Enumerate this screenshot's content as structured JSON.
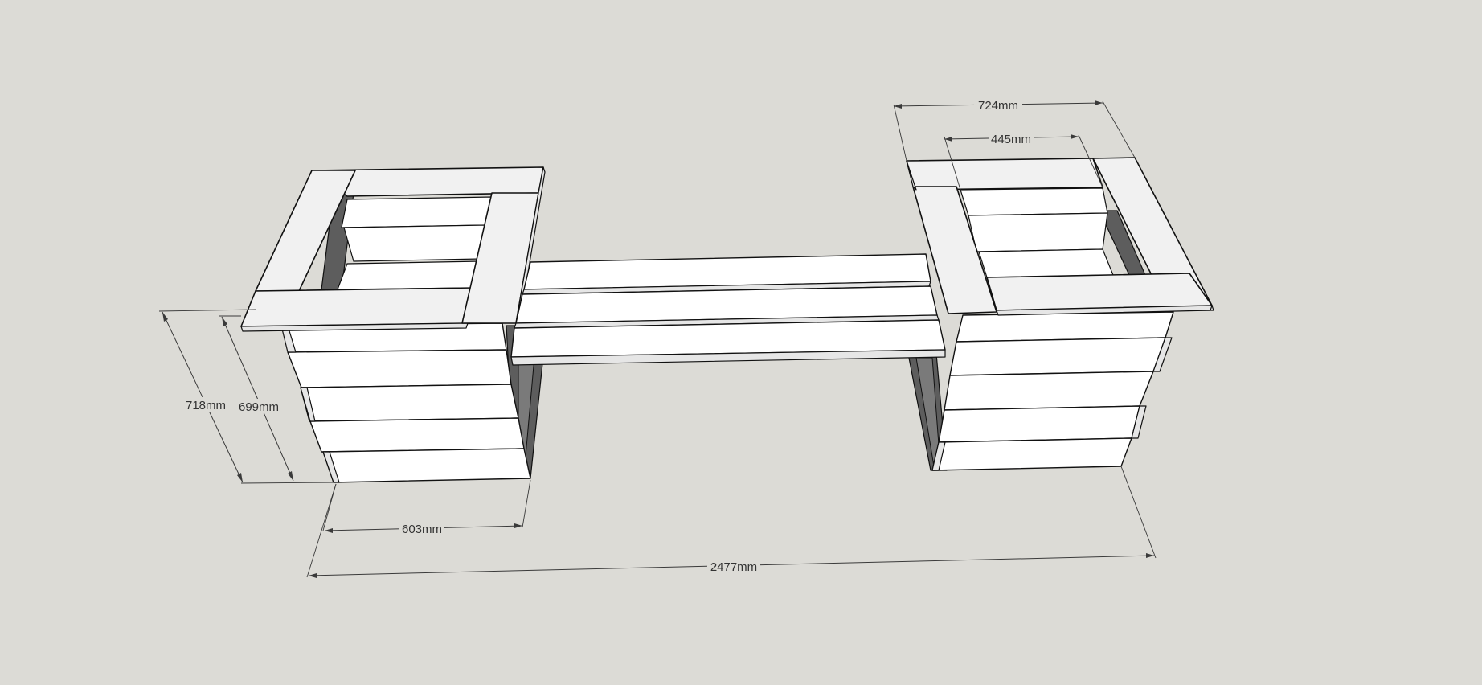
{
  "dimensions": {
    "right_outer_width": "724mm",
    "right_inner_width": "445mm",
    "left_height_overall": "718mm",
    "left_height_box": "699mm",
    "left_box_width": "603mm",
    "total_length": "2477mm"
  },
  "colors": {
    "background": "#dcdbd6",
    "board": "#ffffff",
    "shadow": "#5d5d5d",
    "outline": "#111111"
  }
}
